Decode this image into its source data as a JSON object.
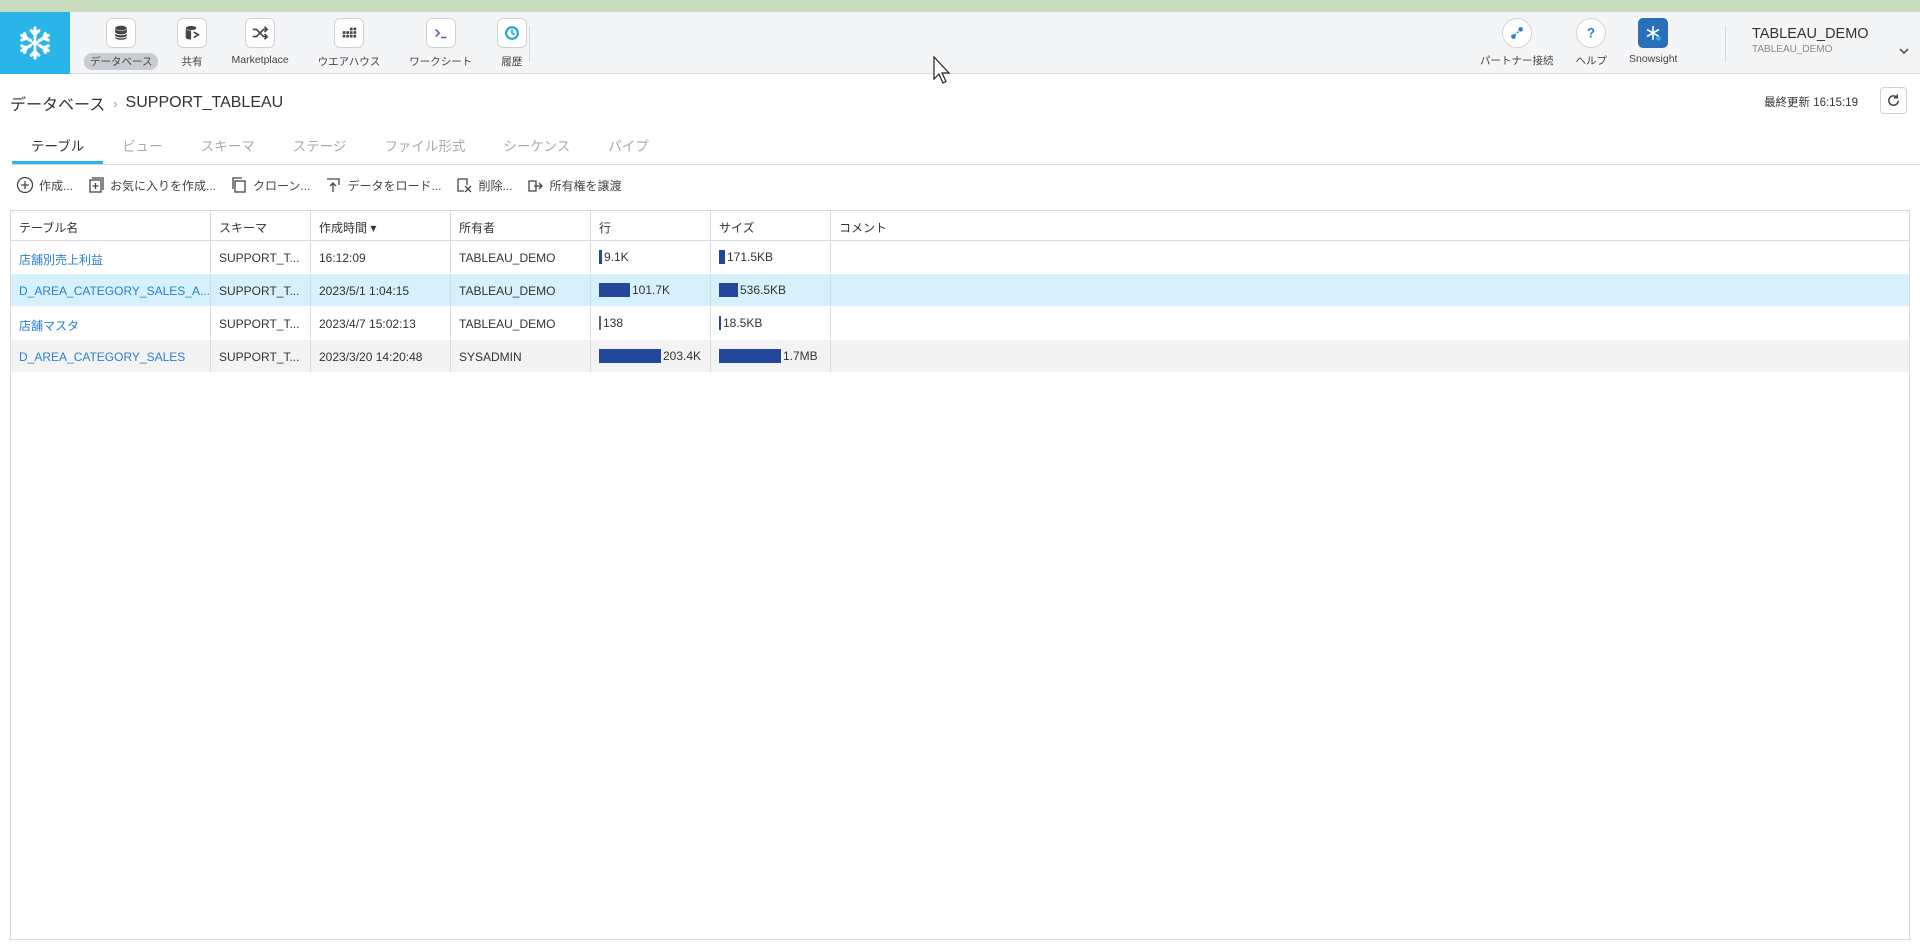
{
  "nav": {
    "items": [
      {
        "label": "データベース",
        "icon": "database-icon",
        "active": true
      },
      {
        "label": "共有",
        "icon": "shared-database-icon",
        "active": false
      },
      {
        "label": "Marketplace",
        "icon": "shuffle-icon",
        "active": false
      },
      {
        "label": "ウエアハウス",
        "icon": "warehouse-icon",
        "active": false
      },
      {
        "label": "ワークシート",
        "icon": "terminal-icon",
        "active": false
      },
      {
        "label": "履歴",
        "icon": "history-icon",
        "active": false
      }
    ]
  },
  "right_nav": {
    "partner_label": "パートナー接続",
    "help_label": "ヘルプ",
    "snowsight_label": "Snowsight"
  },
  "user": {
    "name": "TABLEAU_DEMO",
    "role": "TABLEAU_DEMO"
  },
  "breadcrumb": {
    "root": "データベース",
    "sep": "›",
    "current": "SUPPORT_TABLEAU"
  },
  "last_updated": "最終更新 16:15:19",
  "tabs": [
    {
      "label": "テーブル",
      "active": true
    },
    {
      "label": "ビュー",
      "active": false
    },
    {
      "label": "スキーマ",
      "active": false
    },
    {
      "label": "ステージ",
      "active": false
    },
    {
      "label": "ファイル形式",
      "active": false
    },
    {
      "label": "シーケンス",
      "active": false
    },
    {
      "label": "パイプ",
      "active": false
    }
  ],
  "toolbar": {
    "create": "作成...",
    "create_favorite": "お気に入りを作成...",
    "clone": "クローン...",
    "load_data": "データをロード...",
    "delete": "削除...",
    "transfer_ownership": "所有権を譲渡"
  },
  "table": {
    "headers": [
      "テーブル名",
      "スキーマ",
      "作成時間 ▾",
      "所有者",
      "行",
      "サイズ",
      "コメント"
    ],
    "rows": [
      {
        "name": "店舗別売上利益",
        "schema": "SUPPORT_T...",
        "created": "16:12:09",
        "owner": "TABLEAU_DEMO",
        "rows": "9.1K",
        "rows_fraction": 0.045,
        "size": "171.5KB",
        "size_fraction": 0.1,
        "comment": "",
        "selected": false
      },
      {
        "name": "D_AREA_CATEGORY_SALES_A...",
        "schema": "SUPPORT_T...",
        "created": "2023/5/1 1:04:15",
        "owner": "TABLEAU_DEMO",
        "rows": "101.7K",
        "rows_fraction": 0.5,
        "size": "536.5KB",
        "size_fraction": 0.31,
        "comment": "",
        "selected": true
      },
      {
        "name": "店舗マスタ",
        "schema": "SUPPORT_T...",
        "created": "2023/4/7 15:02:13",
        "owner": "TABLEAU_DEMO",
        "rows": "138",
        "rows_fraction": 0.0,
        "size": "18.5KB",
        "size_fraction": 0.01,
        "comment": "",
        "selected": false
      },
      {
        "name": "D_AREA_CATEGORY_SALES",
        "schema": "SUPPORT_T...",
        "created": "2023/3/20 14:20:48",
        "owner": "SYSADMIN",
        "rows": "203.4K",
        "rows_fraction": 1.0,
        "size": "1.7MB",
        "size_fraction": 1.0,
        "comment": "",
        "selected": false
      }
    ]
  },
  "colors": {
    "brand": "#29b5e8",
    "bar": "#23479a",
    "link": "#2a7fd4",
    "selected_row": "#d6f1fb"
  }
}
